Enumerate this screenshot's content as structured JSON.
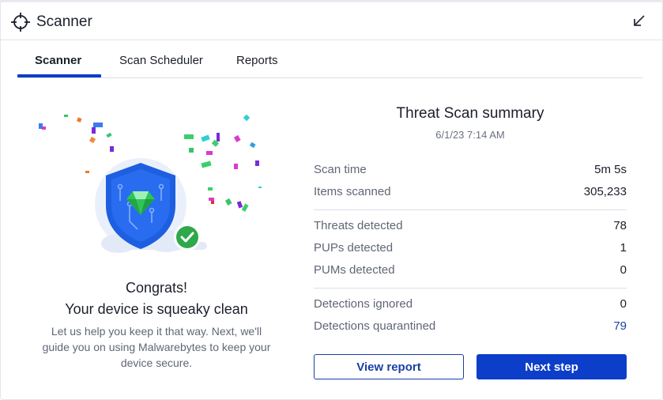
{
  "window": {
    "title": "Scanner",
    "collapse_icon": "collapse-arrow-icon",
    "app_icon": "crosshair-icon"
  },
  "tabs": [
    {
      "label": "Scanner",
      "active": true
    },
    {
      "label": "Scan Scheduler",
      "active": false
    },
    {
      "label": "Reports",
      "active": false
    }
  ],
  "result": {
    "headline_1": "Congrats!",
    "headline_2": "Your device is squeaky clean",
    "description": "Let us help you keep it that way. Next, we'll guide you on using Malwarebytes to keep your device secure."
  },
  "summary": {
    "heading": "Threat Scan summary",
    "date": "6/1/23 7:14 AM",
    "scan_time_label": "Scan time",
    "scan_time_value": "5m 5s",
    "items_scanned_label": "Items scanned",
    "items_scanned_value": "305,233",
    "threats_label": "Threats detected",
    "threats_value": "78",
    "pups_label": "PUPs detected",
    "pups_value": "1",
    "pums_label": "PUMs detected",
    "pums_value": "0",
    "ignored_label": "Detections ignored",
    "ignored_value": "0",
    "quarantined_label": "Detections quarantined",
    "quarantined_value": "79"
  },
  "buttons": {
    "view_report": "View report",
    "next_step": "Next step"
  },
  "colors": {
    "accent": "#0d3ec9",
    "link": "#1a3fa6",
    "success": "#2ea84a",
    "shield": "#1d5fe0"
  }
}
